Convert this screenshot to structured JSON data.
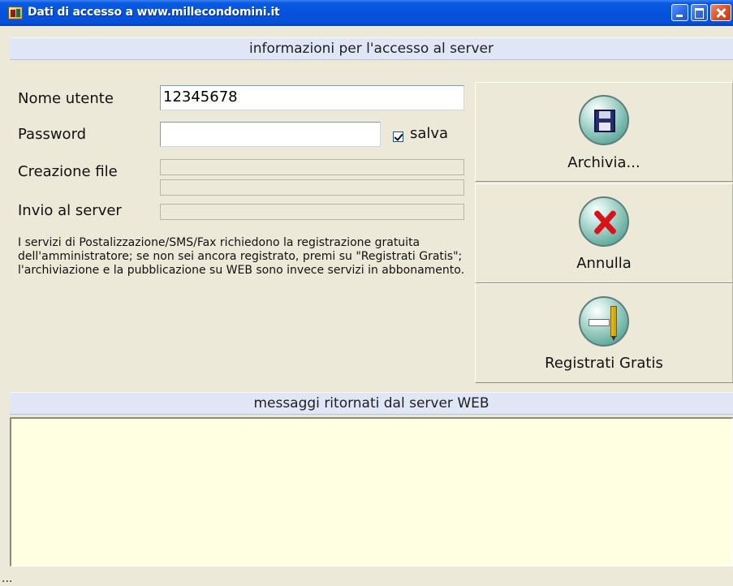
{
  "window": {
    "title": "Dati di accesso a www.millecondomini.it"
  },
  "header": {
    "section_title": "informazioni per l'accesso al server"
  },
  "form": {
    "user_label": "Nome utente",
    "user_value": "12345678",
    "password_label": "Password",
    "password_value": "",
    "save_checkbox_label": "salva",
    "save_checked": true,
    "file_creation_label": "Creazione file",
    "file_creation_progress": 0,
    "file_creation_progress_2": 0,
    "send_label": "Invio al server",
    "send_progress": 0,
    "info_text": "I servizi di Postalizzazione/SMS/Fax richiedono la registrazione gratuita dell'amministratore; se non sei ancora registrato, premi su \"Registrati Gratis\"; l'archiviazione e la pubblicazione su WEB sono invece servizi in abbonamento."
  },
  "actions": {
    "archive_label": "Archivia...",
    "archive_icon": "floppy-disk-icon",
    "cancel_label": "Annulla",
    "cancel_icon": "red-x-icon",
    "register_label": "Registrati Gratis",
    "register_icon": "pen-register-icon"
  },
  "messages": {
    "section_title": "messaggi ritornati dal server WEB",
    "content": ""
  },
  "status": {
    "text": "..."
  },
  "colors": {
    "titlebar": "#0453dd",
    "section_bar": "#dfe6f5",
    "message_bg": "#ffffe1",
    "window_bg": "#ece9d8",
    "cancel_x": "#d8141b"
  }
}
